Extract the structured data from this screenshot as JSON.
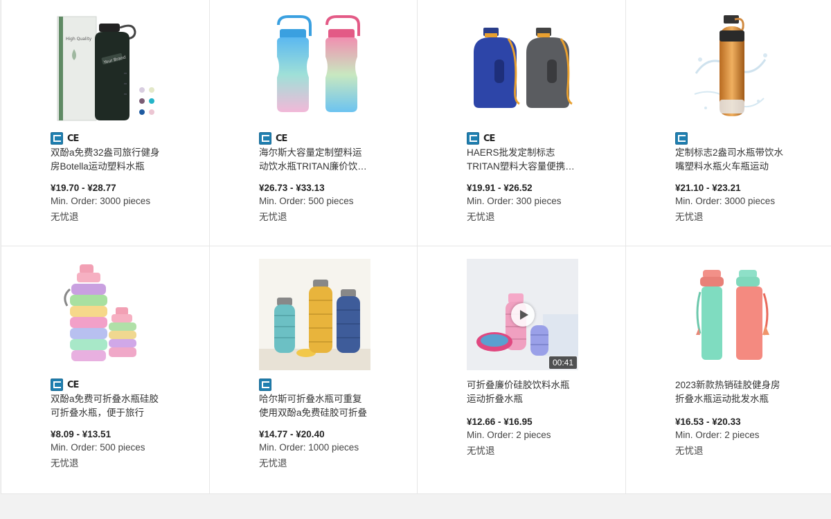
{
  "products": [
    {
      "title": "双酚a免费32盎司旅行健身房Botella运动塑料水瓶",
      "price": "¥19.70 - ¥28.77",
      "min_order": "Min. Order: 3000 pieces",
      "returns": "无忧退",
      "cert_ce": "CE",
      "image": "black-bottle-with-box",
      "box_label": "High Quality",
      "bottle_label": "Your Brand"
    },
    {
      "title": "海尔斯大容量定制塑料运动饮水瓶TRITAN廉价饮水瓶",
      "price": "¥26.73 - ¥33.13",
      "min_order": "Min. Order: 500 pieces",
      "returns": "无忧退",
      "cert_ce": "CE",
      "image": "gradient-bottles-blue-pink"
    },
    {
      "title": "HAERS批发定制标志TRITAN塑料大容量便携水壶",
      "price": "¥19.91 - ¥26.52",
      "min_order": "Min. Order: 300 pieces",
      "returns": "无忧退",
      "cert_ce": "CE",
      "image": "blue-gray-jugs"
    },
    {
      "title": "定制标志2盎司水瓶带饮水嘴塑料水瓶火车瓶运动",
      "price": "¥21.10 - ¥23.21",
      "min_order": "Min. Order: 3000 pieces",
      "returns": "无忧退",
      "cert_ce": "",
      "image": "copper-sport-bottle-splash"
    },
    {
      "title": "双酚a免费可折叠水瓶硅胶可折叠水瓶，便于旅行",
      "price": "¥8.09 - ¥13.51",
      "min_order": "Min. Order: 500 pieces",
      "returns": "无忧退",
      "cert_ce": "CE",
      "image": "rainbow-collapsible-bottles"
    },
    {
      "title": "哈尔斯可折叠水瓶可重复使用双酚a免费硅胶可折叠",
      "price": "¥14.77 - ¥20.40",
      "min_order": "Min. Order: 1000 pieces",
      "returns": "无忧退",
      "cert_ce": "",
      "image": "collapsible-bottles-on-table"
    },
    {
      "title": "可折叠廉价硅胶饮料水瓶运动折叠水瓶",
      "price": "¥12.66 - ¥16.95",
      "min_order": "Min. Order: 2 pieces",
      "returns": "无忧退",
      "cert_ce": "",
      "image": "collapsible-video",
      "duration": "00:41"
    },
    {
      "title": "2023新款热销硅胶健身房折叠水瓶运动批发水瓶",
      "price": "¥16.53 - ¥20.33",
      "min_order": "Min. Order: 2 pieces",
      "returns": "无忧退",
      "cert_ce": "",
      "image": "mint-coral-bottles"
    }
  ]
}
